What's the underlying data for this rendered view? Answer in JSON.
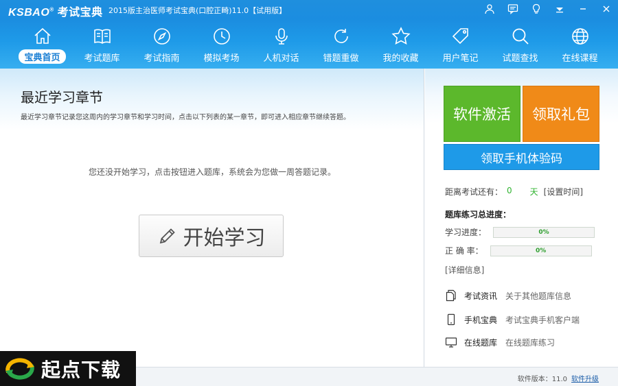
{
  "app": {
    "logo_text": "KSBAO",
    "logo_registered": "®",
    "logo_cn": "考试宝典",
    "window_title": "2015版主治医师考试宝典(口腔正畸)11.0【试用版】"
  },
  "titlebar_icons": [
    "user-icon",
    "message-icon",
    "bulb-icon",
    "dropdown-icon",
    "minimize-icon",
    "close-icon"
  ],
  "nav": {
    "items": [
      {
        "label": "宝典首页",
        "icon": "home-icon",
        "active": true
      },
      {
        "label": "考试题库",
        "icon": "book-icon"
      },
      {
        "label": "考试指南",
        "icon": "compass-icon"
      },
      {
        "label": "模拟考场",
        "icon": "clock-icon"
      },
      {
        "label": "人机对话",
        "icon": "microphone-icon"
      },
      {
        "label": "错题重做",
        "icon": "redo-icon"
      },
      {
        "label": "我的收藏",
        "icon": "star-icon"
      },
      {
        "label": "用户笔记",
        "icon": "tag-icon"
      },
      {
        "label": "试题查找",
        "icon": "search-icon"
      },
      {
        "label": "在线课程",
        "icon": "globe-icon"
      }
    ]
  },
  "main": {
    "title": "最近学习章节",
    "description": "最近学习章节记录您这周内的学习章节和学习时间，点击以下列表的某一章节，即可进入相应章节继续答题。",
    "empty_tip": "您还没开始学习，点击按钮进入题库，系统会为您做一周答题记录。",
    "start_button": "开始学习"
  },
  "side": {
    "activate_label": "软件激活",
    "gift_label": "领取礼包",
    "code_label": "领取手机体验码",
    "countdown_prefix": "距离考试还有：",
    "countdown_days": "0",
    "countdown_unit": "天",
    "countdown_link": "[设置时间]",
    "progress_title": "题库练习总进度：",
    "study_label": "学习进度：",
    "study_value": "0%",
    "study_fraction": 0,
    "accuracy_label": "正 确 率：",
    "accuracy_value": "0%",
    "accuracy_fraction": 0,
    "detail_link": "[详细信息]",
    "info": [
      {
        "key": "考试资讯",
        "value": "关于其他题库信息",
        "icon": "document-icon"
      },
      {
        "key": "手机宝典",
        "value": "考试宝典手机客户端",
        "icon": "phone-icon"
      },
      {
        "key": "在线题库",
        "value": "在线题库练习",
        "icon": "monitor-icon"
      }
    ]
  },
  "status": {
    "version_text": "软件版本：11.0",
    "upgrade_link": "软件升级"
  },
  "watermark": {
    "text": "起点下载"
  },
  "colors": {
    "topbar": "#1e9ae8",
    "activate": "#5cb82c",
    "gift": "#f08a18",
    "code": "#1e9ae8"
  }
}
